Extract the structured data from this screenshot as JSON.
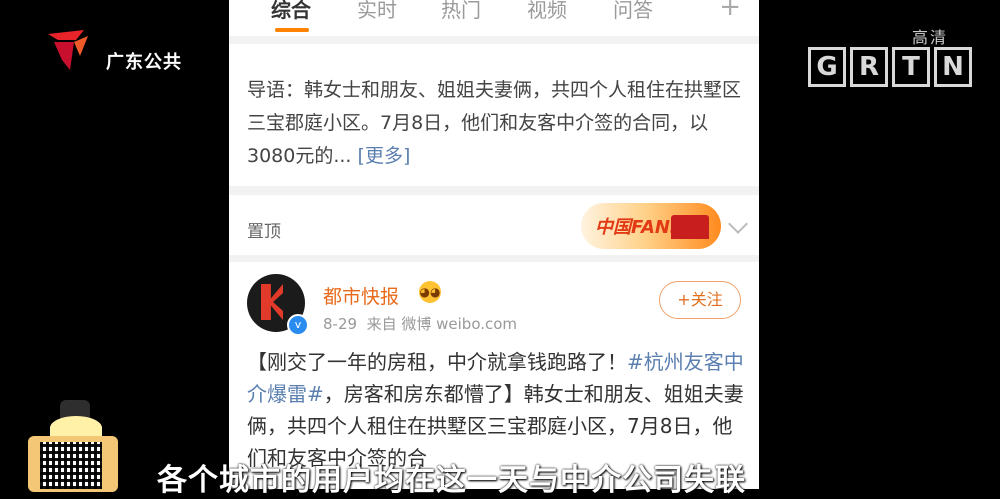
{
  "tabs": [
    {
      "label": "综合",
      "active": true
    },
    {
      "label": "实时",
      "active": false
    },
    {
      "label": "热门",
      "active": false
    },
    {
      "label": "视频",
      "active": false
    },
    {
      "label": "问答",
      "active": false
    }
  ],
  "tabs_more": "+",
  "intro": {
    "text": "导语：韩女士和朋友、姐姐夫妻俩，共四个人租住在拱墅区三宝郡庭小区。7月8日，他们和友客中介签的合同，以3080元的...",
    "more": "[更多]"
  },
  "pinned": {
    "label": "置顶",
    "badge_text": "中国FANS"
  },
  "post": {
    "author": "都市快报",
    "date": "8-29",
    "source": "来自 微博 weibo.com",
    "follow_label": "+关注",
    "body_prefix": "【刚交了一年的房租，中介就拿钱跑路了！",
    "topic": "#杭州友客中介爆雷#",
    "body_suffix": "，房客和房东都懵了】韩女士和朋友、姐姐夫妻俩，共四个人租住在拱墅区三宝郡庭小区，7月8日，他们和友客中介签的合"
  },
  "channel": {
    "logo_text": "广东公共",
    "quality": "高清",
    "letters": [
      "G",
      "R",
      "T",
      "N"
    ]
  },
  "subtitle": "各个城市的用户均在这一天与中介公司失联",
  "colors": {
    "accent": "#ff8200",
    "link": "#5b80b0",
    "author": "#e86a1a",
    "background": "#000000"
  }
}
